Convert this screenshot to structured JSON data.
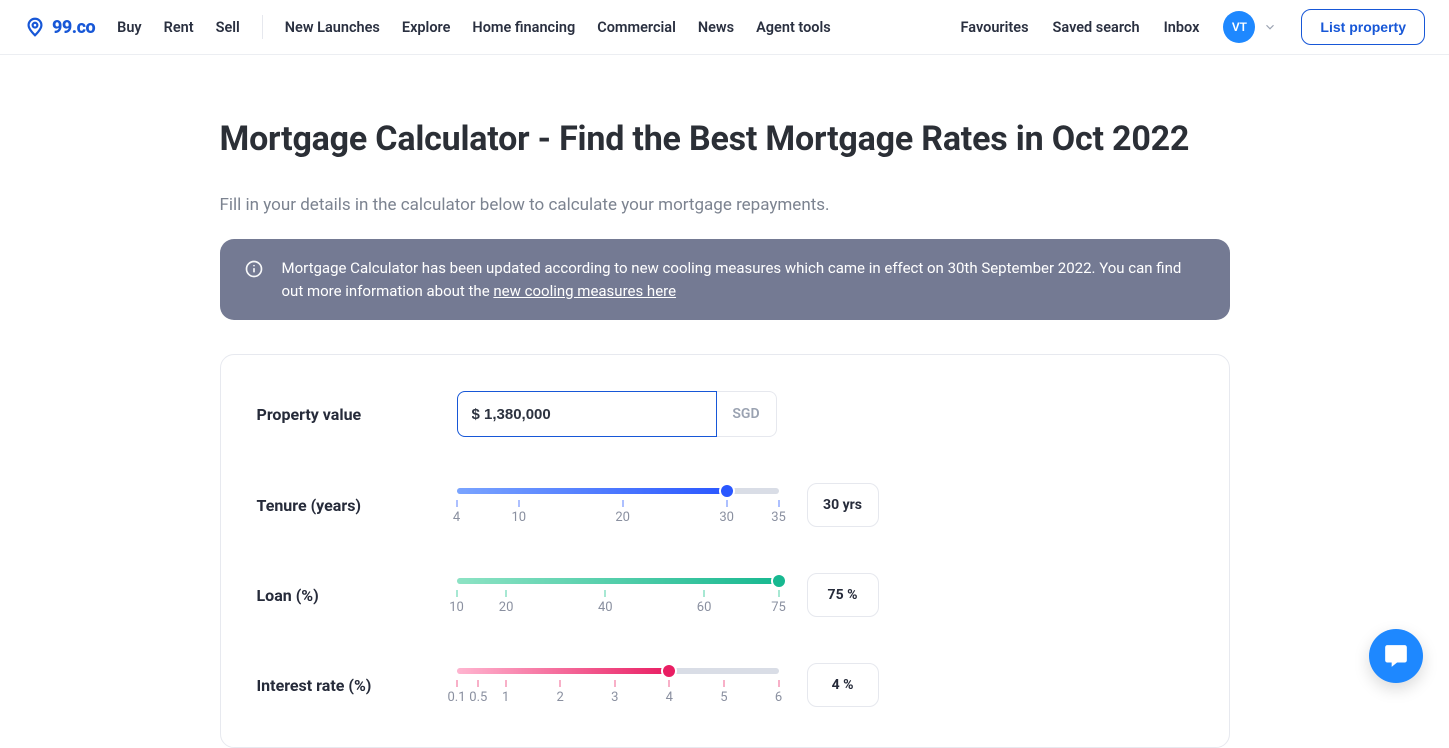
{
  "brand": {
    "name": "99.co"
  },
  "nav": {
    "left": [
      "Buy",
      "Rent",
      "Sell"
    ],
    "left2": [
      "New Launches",
      "Explore",
      "Home financing",
      "Commercial",
      "News",
      "Agent tools"
    ],
    "right": [
      "Favourites",
      "Saved search",
      "Inbox"
    ],
    "avatar": "VT",
    "list_btn": "List property"
  },
  "page": {
    "title": "Mortgage Calculator - Find the Best Mortgage Rates in Oct 2022",
    "subtitle": "Fill in your details in the calculator below to calculate your mortgage repayments.",
    "notice_text_1": "Mortgage Calculator has been updated according to new cooling measures which came in effect on 30th September 2022. You can find out more information about the ",
    "notice_link_text": "new cooling measures here"
  },
  "calc": {
    "property_value_label": "Property value",
    "property_value_input": "$ 1,380,000",
    "currency": "SGD",
    "tenure_label": "Tenure (years)",
    "tenure_out": "30 yrs",
    "tenure_ticks": [
      "4",
      "10",
      "20",
      "30",
      "35"
    ],
    "tenure_tick_pos": [
      0,
      19.35,
      51.6,
      83.9,
      100
    ],
    "tenure_fill_pct": 83.9,
    "loan_label": "Loan (%)",
    "loan_out": "75 %",
    "loan_ticks": [
      "10",
      "20",
      "40",
      "60",
      "75"
    ],
    "loan_tick_pos": [
      0,
      15.4,
      46.2,
      76.9,
      100
    ],
    "loan_fill_pct": 100,
    "rate_label": "Interest rate (%)",
    "rate_out": "4 %",
    "rate_ticks": [
      "0.1",
      "0.5",
      "1",
      "2",
      "3",
      "4",
      "5",
      "6"
    ],
    "rate_tick_pos": [
      0,
      6.78,
      15.25,
      32.2,
      49.15,
      66.1,
      83.05,
      100
    ],
    "rate_fill_pct": 66.1
  }
}
